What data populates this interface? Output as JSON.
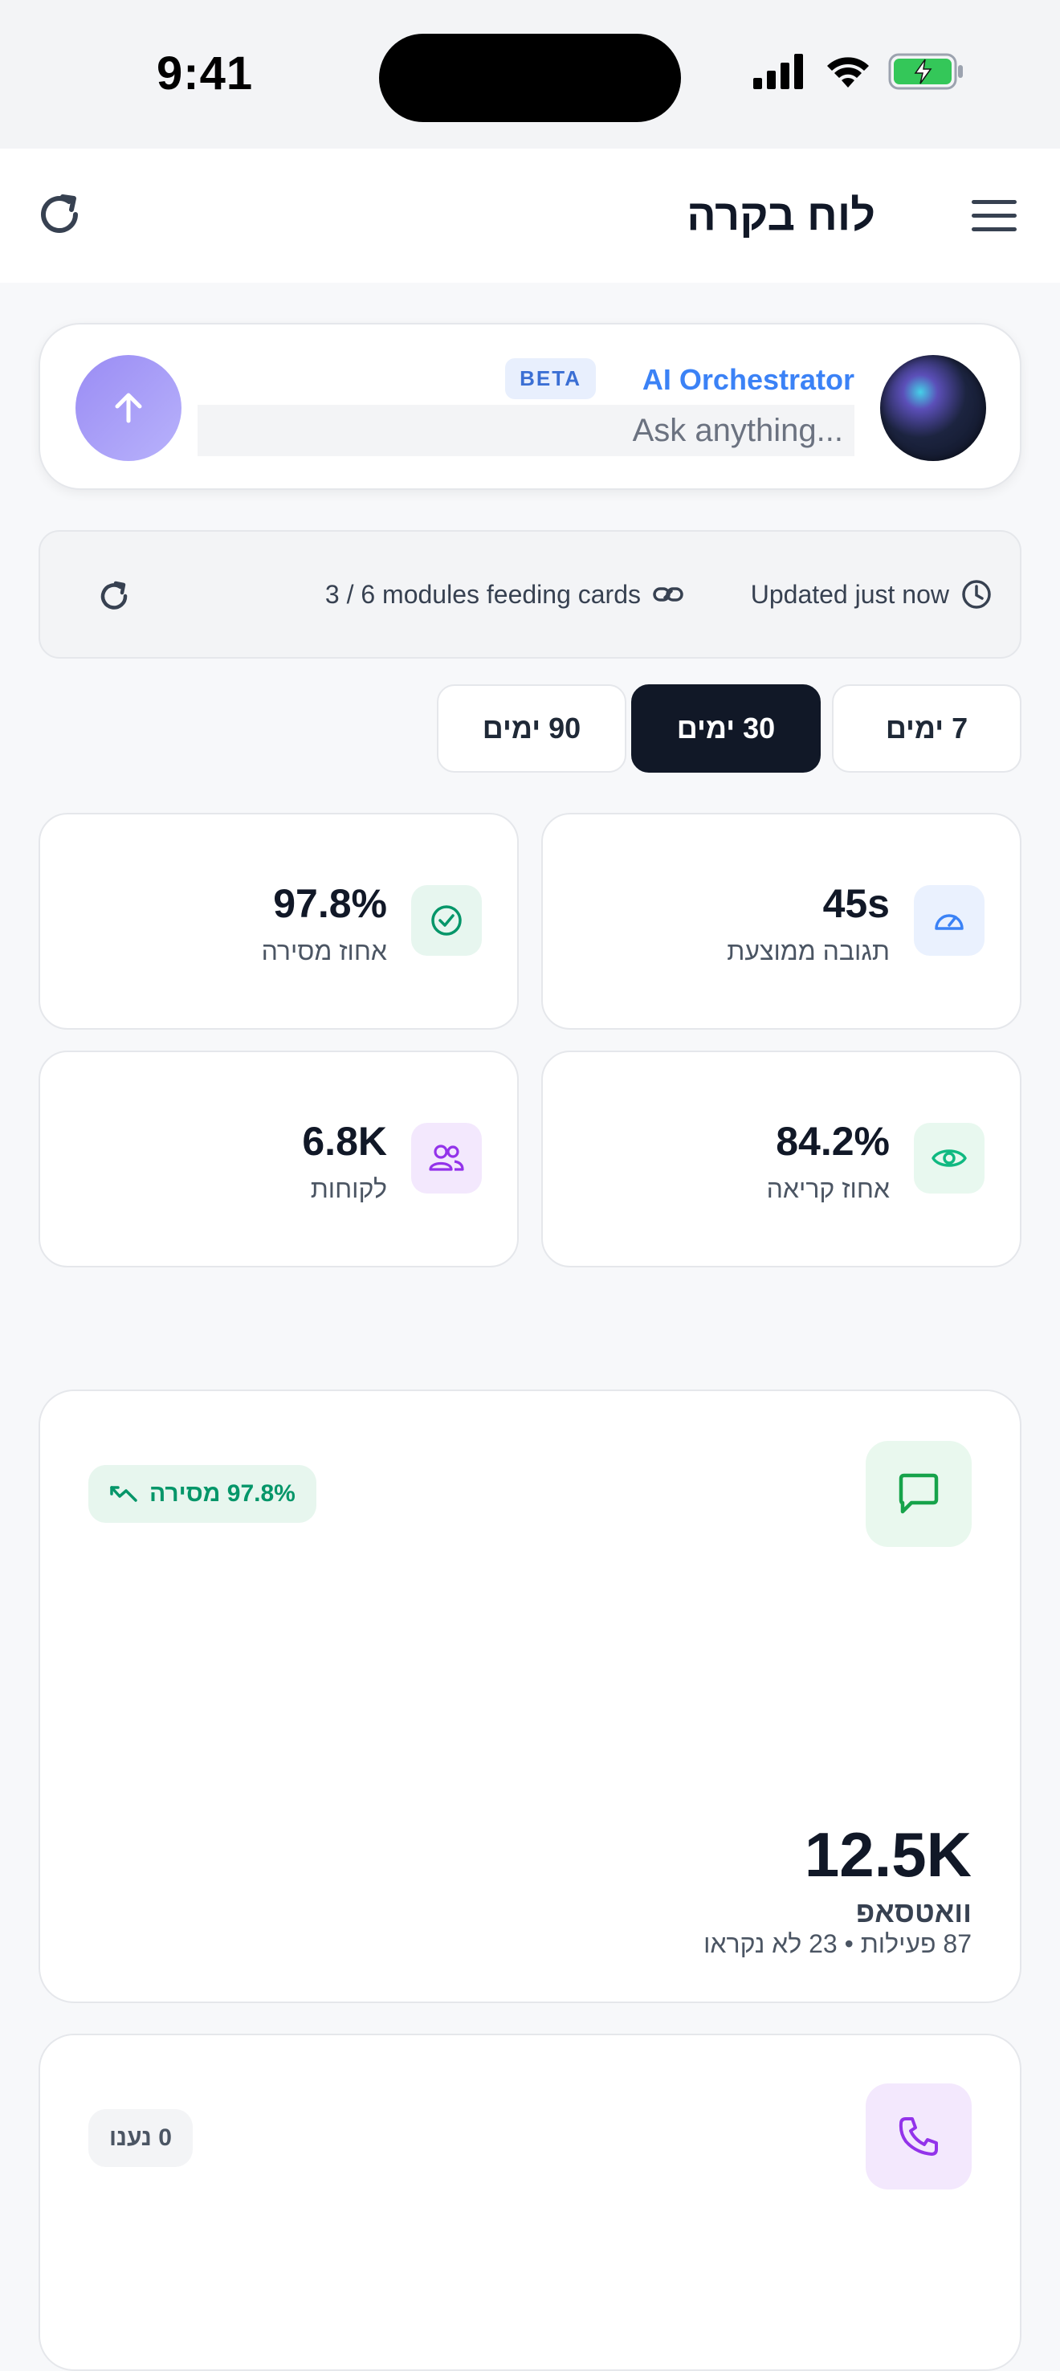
{
  "status_bar": {
    "time": "9:41",
    "icons": [
      "signal-icon",
      "wifi-icon",
      "battery-charging-icon"
    ]
  },
  "header": {
    "title": "לוח בקרה",
    "icons": [
      "menu-icon",
      "refresh-icon"
    ]
  },
  "ai_orchestrator": {
    "name": "AI Orchestrator",
    "badge": "BETA",
    "placeholder": "Ask anything...",
    "send_icon": "arrow-up-icon"
  },
  "sync_status": {
    "updated": "Updated just now",
    "modules": "3 / 6 modules feeding cards",
    "icons": [
      "clock-icon",
      "link-icon",
      "refresh-icon"
    ]
  },
  "time_ranges": [
    {
      "label": "7 ימים",
      "active": false
    },
    {
      "label": "30 ימים",
      "active": true
    },
    {
      "label": "90 ימים",
      "active": false
    }
  ],
  "stats": [
    {
      "value": "45s",
      "label": "תגובה ממוצעת",
      "icon": "gauge-icon",
      "color": "#3b82f6"
    },
    {
      "value": "97.8%",
      "label": "אחוז מסירה",
      "icon": "check-circle-icon",
      "color": "#059669"
    },
    {
      "value": "84.2%",
      "label": "אחוז קריאה",
      "icon": "eye-icon",
      "color": "#10b981"
    },
    {
      "value": "6.8K",
      "label": "לקוחות",
      "icon": "users-icon",
      "color": "#9333ea"
    }
  ],
  "channels": [
    {
      "icon": "chat-icon",
      "icon_color": "#16a34a",
      "badge": "97.8% מסירה",
      "badge_icon": "trend-icon",
      "value": "12.5K",
      "name": "וואטסאפ",
      "sub": "87 פעילות • 23 לא נקראו"
    },
    {
      "icon": "phone-icon",
      "icon_color": "#9333ea",
      "badge": "0 נענו"
    }
  ],
  "colors": {
    "accent": "#3b82f6",
    "dark": "#111827",
    "success": "#059669",
    "purple": "#9333ea"
  }
}
